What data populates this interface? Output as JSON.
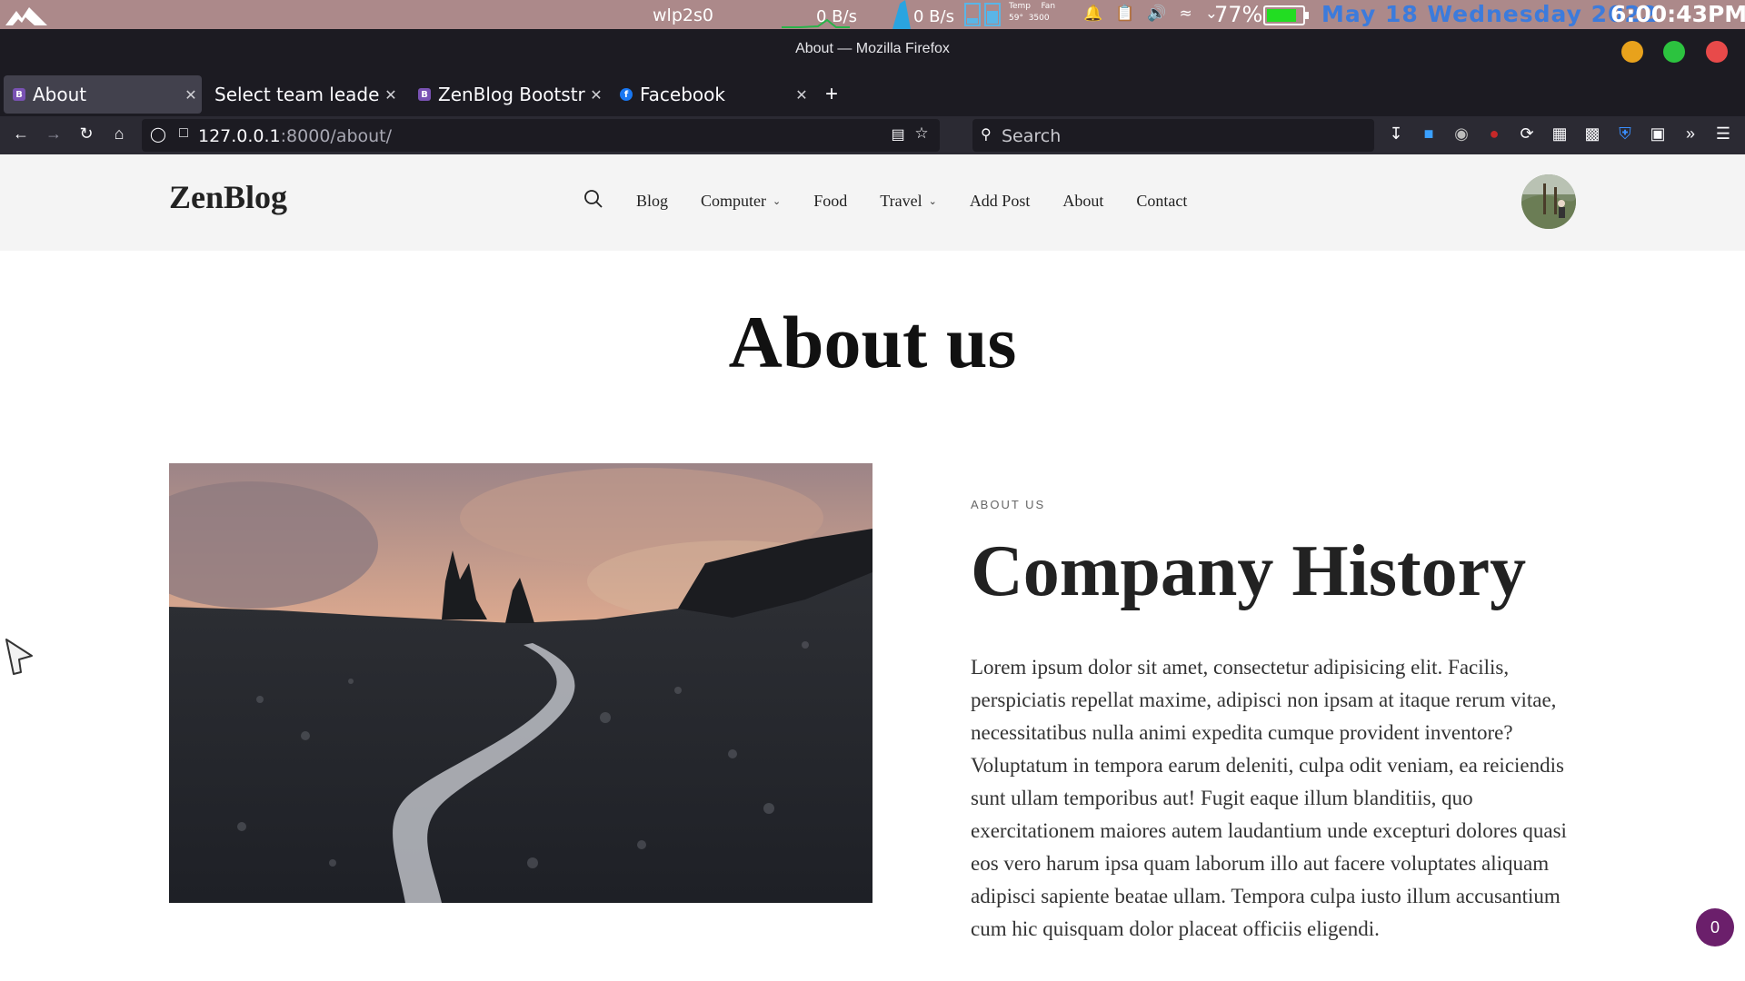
{
  "system_panel": {
    "network_interface": "wlp2s0",
    "download_rate": "0 B/s",
    "upload_rate": "0 B/s",
    "temp_label": "Temp",
    "temp_value": "59°",
    "fan_label": "Fan",
    "fan_value": "3500",
    "battery_percent": "77%",
    "battery_level": 0.77,
    "date": "May 18 Wednesday 2022",
    "time": "6:00:43PM",
    "accent_color": "#3c7bdc"
  },
  "window": {
    "title": "About — Mozilla Firefox",
    "buttons": [
      "minimize",
      "maximize",
      "close"
    ]
  },
  "tabs": [
    {
      "label": "About",
      "favicon": "B",
      "active": true
    },
    {
      "label": "Select team leader to",
      "favicon": "",
      "active": false
    },
    {
      "label": "ZenBlog Bootstrap",
      "favicon": "B",
      "active": false
    },
    {
      "label": "Facebook",
      "favicon": "f",
      "active": false
    }
  ],
  "navbar": {
    "url_host": "127.0.0.1",
    "url_rest": ":8000/about/",
    "search_placeholder": "Search"
  },
  "site": {
    "brand": "ZenBlog",
    "nav": [
      {
        "label": "Blog"
      },
      {
        "label": "Computer",
        "dropdown": true
      },
      {
        "label": "Food"
      },
      {
        "label": "Travel",
        "dropdown": true
      },
      {
        "label": "Add Post"
      },
      {
        "label": "About"
      },
      {
        "label": "Contact"
      }
    ]
  },
  "main": {
    "page_title": "About us",
    "eyebrow": "ABOUT US",
    "section_title": "Company History",
    "section_body": "Lorem ipsum dolor sit amet, consectetur adipisicing elit. Facilis, perspiciatis repellat maxime, adipisci non ipsam at itaque rerum vitae, necessitatibus nulla animi expedita cumque provident inventore? Voluptatum in tempora earum deleniti, culpa odit veniam, ea reiciendis sunt ullam temporibus aut! Fugit eaque illum blanditiis, quo exercitationem maiores autem laudantium unde excepturi dolores quasi eos vero harum ipsa quam laborum illo aut facere voluptates aliquam adipisci sapiente beatae ullam. Tempora culpa iusto illum accusantium cum hic quisquam dolor placeat officiis eligendi."
  },
  "counter_badge": "0"
}
